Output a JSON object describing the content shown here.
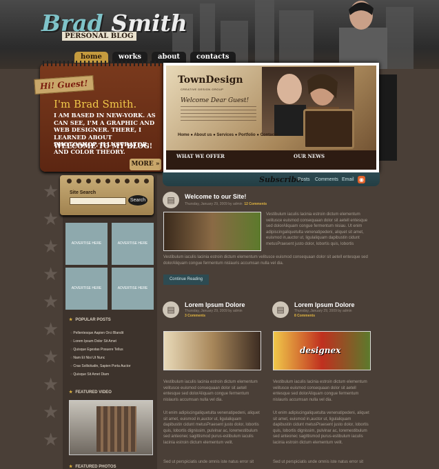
{
  "header": {
    "brand_first": "Brad",
    "brand_last": " Smith",
    "brand_sub": "PERSONAL BLOG"
  },
  "nav": [
    "home",
    "works",
    "about",
    "contacts"
  ],
  "intro": {
    "tag": "Hi! Guest!",
    "title": "I'm Brad Smith.",
    "text": "I AM BASED IN NEW-YORK. AS CAN SEE, I'M A GRAPHIC AND WEB DESIGNER. THERE, I LEARNED ABOUT PHOTOSHOP, ILLUSTRATOR, AND COLOR THEORY.",
    "welcome": "WELCOME TO MY BLOG!",
    "more": "MORE"
  },
  "slideshow": {
    "logo": "TownDesign",
    "logo_sub": "CREATIVE DESIGN GROUP",
    "welcome": "Welcome Dear Guest!",
    "menu": "Home  ● About us  ● Services  ● Portfolio  ● Contacts",
    "bar_left": "WHAT WE OFFER",
    "bar_right": "OUR NEWS"
  },
  "subscribe": {
    "label": "Subscribe:",
    "links": [
      "Posts",
      "Comments",
      "Email"
    ]
  },
  "search": {
    "label": "Site Search",
    "button": "Search"
  },
  "ads": [
    "ADVERTISE HERE",
    "ADVERTISE HERE",
    "ADVERTISE HERE",
    "ADVERTISE HERE"
  ],
  "popular": {
    "title": "POPULAR POSTS",
    "items": [
      "Pellentesque Aapien Orci Blandit",
      "Lorem Ipsum Dolor Sit Amet",
      "Quisque Egestas Posuere Tellus",
      "Nam Et Nisi Ut Nunc",
      "Cras Sollicitudin, Sapien Porta Auctor",
      "Quisque Sit Amet Diam"
    ]
  },
  "video": {
    "title": "FEATURED VIDEO"
  },
  "photos": {
    "title": "FEATURED PHOTOS"
  },
  "main_post": {
    "title": "Welcome to our Site!",
    "meta": "Thursday, January 29, 2009 by admin",
    "comments": "12 Comments",
    "body": "Vestibulum iaculis lacinia estroin dictum elementum velitusce euismod consequaan dolor sit aetell entesque sed dolorAliquam congue fermentum nisiau. Ut enim adipiscingaliquetulta venenatipedeni, aliquet sit amet, euismod in,auctor ut, ligulaliquam dapibustin cidunt metusPraesent justo dolor, lobortis quis, lobortis",
    "body2": "Vestibulum iaculis lacinia estroin dictum elementum velitusce euismod consequaan dolor sit aetell entesque sed dolorAliquam congue fermentum nislauris accumsan nulla vel dia.",
    "read_more": "Continue Reading"
  },
  "posts": [
    {
      "title": "Lorem Ipsum Dolore",
      "meta": "Thursday, January 29, 2009 by admin",
      "comments": "3 Comments",
      "thumb_text": "",
      "p1": "Vestibulum iaculis lacinia estroin dictum elementum velitusce euismod consequaan dolor sit aetell entesque sed dolorAliquam congue fermentum nislauris accumsan nulla vel dia.",
      "p2": "Ut enim adipiscingaliquetulta venenatipedeni, aliquet sit amet, euismod in,auctor ut, ligulaliquam dapibustin cidunt metusPraesent justo dolor, lobortis quis, lobortis dignissim, pulvinar ac, loremestibulum sed anteonec sagittismod purus-estibulum iaculis lacinia estroin dictum elementum velit.",
      "p3": "Sed ut perspiciatis unde omnis iste natus error sit"
    },
    {
      "title": "Lorem Ipsum Dolore",
      "meta": "Thursday, January 29, 2009 by admin",
      "comments": "8 Comments",
      "thumb_text": "designex",
      "p1": "Vestibulum iaculis lacinia estroin dictum elementum velitusce euismod consequaan dolor sit aetell entesque sed dolorAliquam congue fermentum nislauris accumsan nulla vel dia.",
      "p2": "Ut enim adipiscingaliquetulta venenatipedeni, aliquet sit amet, euismod in,auctor ut, ligulaliquam dapibustin cidunt metusPraesent justo dolor, lobortis quis, lobortis dignissim, pulvinar ac, loremestibulum sed anteonec sagittismod purus-estibulum iaculis lacinia estroin dictum elementum velit.",
      "p3": "Sed ut perspiciatis unde omnis iste natus error sit"
    }
  ]
}
